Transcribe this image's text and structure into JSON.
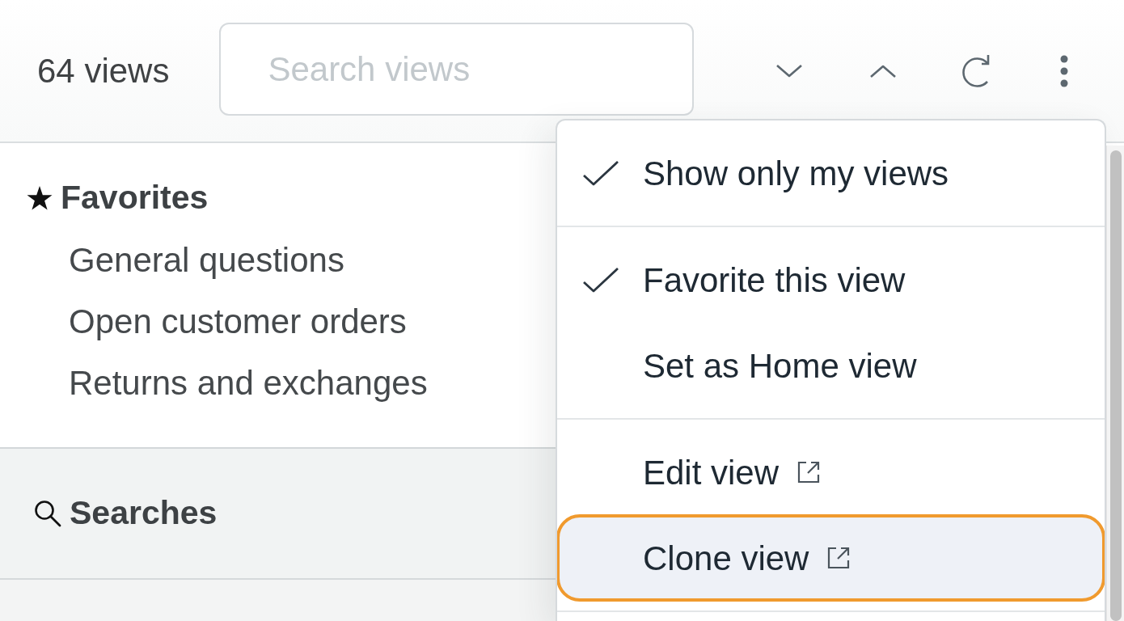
{
  "header": {
    "view_count": "64 views",
    "search": {
      "placeholder": "Search views"
    }
  },
  "sidebar": {
    "sections": [
      {
        "kind": "favorites",
        "title": "Favorites",
        "items": [
          "General questions",
          "Open customer orders",
          "Returns and exchanges"
        ]
      },
      {
        "kind": "searches",
        "title": "Searches"
      }
    ]
  },
  "menu": {
    "groups": [
      {
        "items": [
          {
            "kind": "check",
            "label": "Show only my views",
            "checked": true,
            "selected": false
          }
        ]
      },
      {
        "items": [
          {
            "kind": "check",
            "label": "Favorite this view",
            "checked": true,
            "selected": false
          },
          {
            "kind": "check",
            "label": "Set as Home view",
            "checked": false,
            "selected": false
          }
        ]
      },
      {
        "items": [
          {
            "kind": "link",
            "label": "Edit view",
            "selected": false
          },
          {
            "kind": "link",
            "label": "Clone view",
            "selected": true
          }
        ]
      }
    ]
  }
}
